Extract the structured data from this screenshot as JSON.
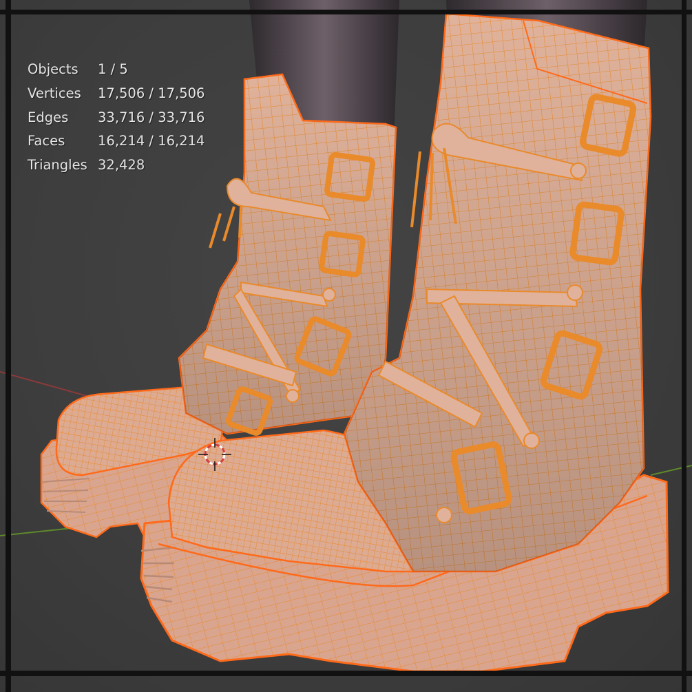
{
  "viewport": {
    "background_color": "#3d3d3d",
    "frame_color": "#111111",
    "selection_outline_color": "#ff6a1a",
    "wireframe_color": "#e98a2b",
    "mesh_color": "#e0b29b",
    "x_axis_color": "#8a3a3a",
    "y_axis_color": "#5e8a2a"
  },
  "statistics": {
    "rows": [
      {
        "label": "Objects",
        "value": "1 / 5"
      },
      {
        "label": "Vertices",
        "value": "17,506 / 17,506"
      },
      {
        "label": "Edges",
        "value": "33,716 / 33,716"
      },
      {
        "label": "Faces",
        "value": "16,214 / 16,214"
      },
      {
        "label": "Triangles",
        "value": "32,428"
      }
    ]
  },
  "scene": {
    "objects": [
      "boot-left",
      "boot-right",
      "leg-left",
      "leg-right"
    ],
    "cursor_icon": "3d-cursor-icon"
  }
}
